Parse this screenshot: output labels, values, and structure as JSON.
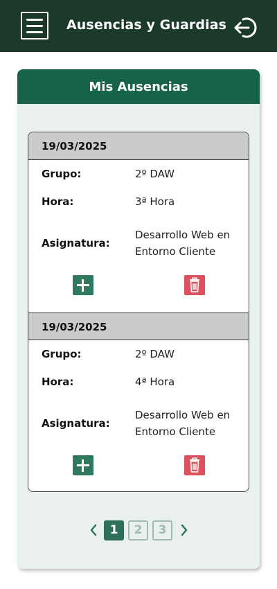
{
  "header": {
    "title": "Ausencias y Guardias",
    "menu_icon": "hamburger-menu-icon",
    "logout_icon": "logout-arrow-icon",
    "bg_color": "#1c3a2c"
  },
  "card": {
    "title": "Mis Ausencias",
    "header_color": "#17634a"
  },
  "entries": [
    {
      "date": "19/03/2025",
      "grupo_label": "Grupo:",
      "grupo": "2º DAW",
      "hora_label": "Hora:",
      "hora": "3ª Hora",
      "asignatura_label": "Asignatura:",
      "asignatura_line1": "Desarrollo Web en",
      "asignatura_line2": "Entorno Cliente"
    },
    {
      "date": "19/03/2025",
      "grupo_label": "Grupo:",
      "grupo": "2º DAW",
      "hora_label": "Hora:",
      "hora": "4ª Hora",
      "asignatura_label": "Asignatura:",
      "asignatura_line1": "Desarrollo Web en",
      "asignatura_line2": "Entorno Cliente"
    }
  ],
  "pagination": {
    "pages": [
      "1",
      "2",
      "3"
    ],
    "current": "1",
    "prev_icon": "chevron-left-icon",
    "next_icon": "chevron-right-icon"
  }
}
